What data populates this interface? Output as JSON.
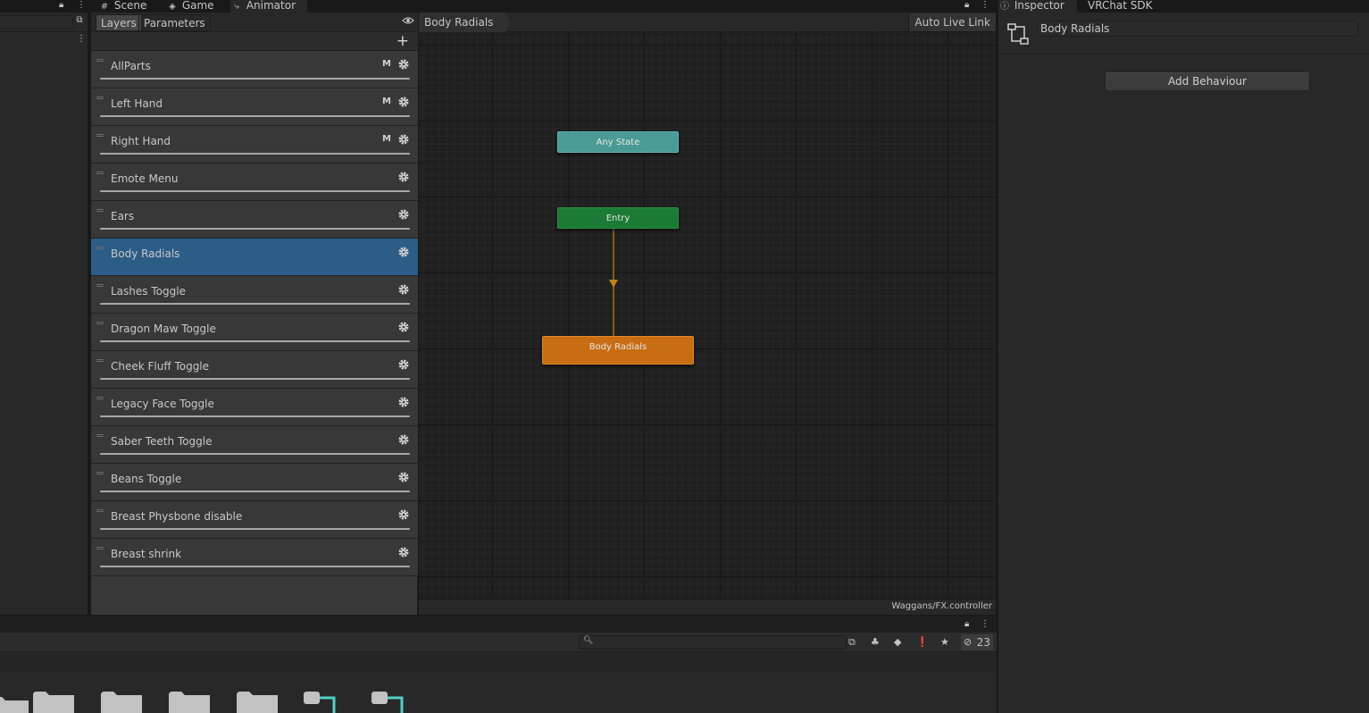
{
  "top_tabs": [
    {
      "label": "Scene",
      "icon": "hash-icon"
    },
    {
      "label": "Game",
      "icon": "gamepad-icon"
    },
    {
      "label": "Animator",
      "icon": "animator-icon"
    }
  ],
  "inspector_tabs": [
    {
      "label": "Inspector",
      "icon": "info-icon"
    },
    {
      "label": "VRChat SDK"
    }
  ],
  "layers_panel": {
    "tabs": [
      "Layers",
      "Parameters"
    ],
    "selected_tab": "Layers",
    "layers": [
      {
        "name": "AllParts",
        "m": "M",
        "selected": false
      },
      {
        "name": "Left Hand",
        "m": "M",
        "selected": false
      },
      {
        "name": "Right Hand",
        "m": "M",
        "selected": false
      },
      {
        "name": "Emote Menu",
        "m": "",
        "selected": false
      },
      {
        "name": "Ears",
        "m": "",
        "selected": false
      },
      {
        "name": "Body Radials",
        "m": "",
        "selected": true
      },
      {
        "name": "Lashes Toggle",
        "m": "",
        "selected": false
      },
      {
        "name": "Dragon Maw Toggle",
        "m": "",
        "selected": false
      },
      {
        "name": "Cheek Fluff Toggle",
        "m": "",
        "selected": false
      },
      {
        "name": "Legacy Face Toggle",
        "m": "",
        "selected": false
      },
      {
        "name": "Saber Teeth Toggle",
        "m": "",
        "selected": false
      },
      {
        "name": "Beans Toggle",
        "m": "",
        "selected": false
      },
      {
        "name": "Breast Physbone disable",
        "m": "",
        "selected": false
      },
      {
        "name": "Breast shrink",
        "m": "",
        "selected": false
      }
    ]
  },
  "graph": {
    "breadcrumb": "Body Radials",
    "auto_live_link": "Auto Live Link",
    "states": {
      "any_state": "Any State",
      "entry": "Entry",
      "default_state": "Body Radials"
    },
    "colors": {
      "any_state": "#4a9a96",
      "entry": "#1b7a34",
      "default_state": "#c86d12",
      "transition": "#c0841c"
    },
    "controller_path": "Waggans/FX.controller"
  },
  "inspector": {
    "object_name": "Body Radials",
    "add_behaviour": "Add Behaviour"
  },
  "project": {
    "hidden_count": "23"
  }
}
